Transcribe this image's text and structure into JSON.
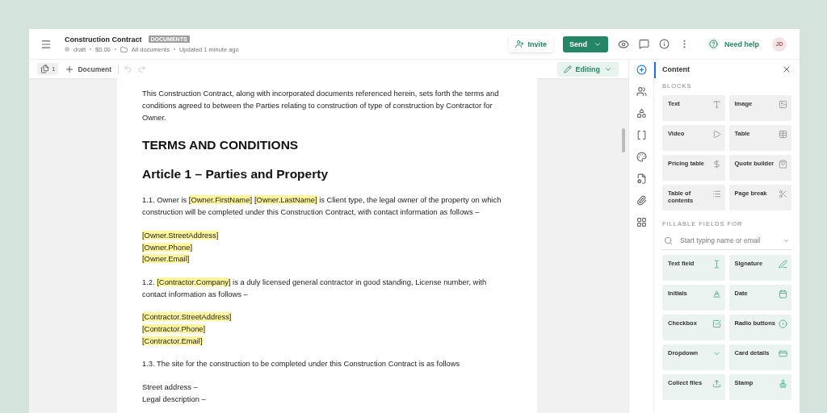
{
  "header": {
    "title": "Construction Contract",
    "badge": "DOCUMENTS",
    "meta": [
      {
        "kind": "status",
        "text": "draft"
      },
      {
        "kind": "plain",
        "text": "$0.00"
      },
      {
        "kind": "folder",
        "text": "All documents"
      },
      {
        "kind": "plain",
        "text": "Updated 1 minute ago"
      }
    ],
    "invite": "Invite",
    "send": "Send",
    "help": "Need help",
    "avatar": "JD"
  },
  "toolbar": {
    "page_count": "1",
    "add_document": "Document",
    "undo_disabled": true,
    "redo_disabled": true,
    "mode": "Editing"
  },
  "document": [
    {
      "kind": "paragraph",
      "parts": [
        {
          "kind": "plain",
          "text": "This Construction Contract, along with incorporated documents referenced herein, sets forth the terms and conditions agreed to between the Parties relating to construction of type of construction by Contractor for Owner."
        }
      ]
    },
    {
      "kind": "title",
      "parts": [
        {
          "kind": "plain",
          "text": "TERMS AND CONDITIONS"
        }
      ]
    },
    {
      "kind": "heading",
      "parts": [
        {
          "kind": "plain",
          "text": "Article 1 – Parties and Property"
        }
      ]
    },
    {
      "kind": "paragraph",
      "parts": [
        {
          "kind": "plain",
          "text": "1.1. Owner is "
        },
        {
          "kind": "token",
          "text": "[Owner.FirstName]"
        },
        {
          "kind": "token",
          "text": "[Owner.LastName]"
        },
        {
          "kind": "plain",
          "text": " is Client type, the legal owner of the property on which construction will be completed under this Construction Contract, with contact information as follows –"
        }
      ]
    },
    {
      "kind": "fields",
      "parts": [
        {
          "kind": "token",
          "text": "[Owner.StreetAddress]"
        },
        {
          "kind": "token",
          "text": "[Owner.Phone]"
        },
        {
          "kind": "token",
          "text": "[Owner.Email]"
        }
      ]
    },
    {
      "kind": "paragraph",
      "parts": [
        {
          "kind": "plain",
          "text": "1.2. "
        },
        {
          "kind": "token",
          "text": "[Contractor.Company]"
        },
        {
          "kind": "plain",
          "text": " is a duly licensed general contractor in good standing, License number, with contact information as follows –"
        }
      ]
    },
    {
      "kind": "fields",
      "parts": [
        {
          "kind": "token",
          "text": "[Contractor.StreetAddress]"
        },
        {
          "kind": "token",
          "text": "[Contractor.Phone]"
        },
        {
          "kind": "token",
          "text": "[Contractor.Email]"
        }
      ]
    },
    {
      "kind": "paragraph",
      "parts": [
        {
          "kind": "plain",
          "text": "1.3. The site for the construction to be completed under this Construction Contract is as follows"
        }
      ]
    },
    {
      "kind": "fields",
      "parts": [
        {
          "kind": "plain",
          "text": "Street address –"
        },
        {
          "kind": "plain",
          "text": "Legal description –"
        }
      ]
    }
  ],
  "rail": [
    {
      "selected": true
    },
    {
      "selected": false
    },
    {
      "selected": false
    },
    {
      "selected": false
    },
    {
      "selected": false
    },
    {
      "selected": false
    },
    {
      "selected": false
    },
    {
      "selected": false
    }
  ],
  "panel": {
    "title": "Content",
    "blocks_heading": "BLOCKS",
    "blocks": [
      {
        "label": "Text"
      },
      {
        "label": "Image"
      },
      {
        "label": "Video"
      },
      {
        "label": "Table"
      },
      {
        "label": "Pricing table"
      },
      {
        "label": "Quote builder"
      },
      {
        "label": "Table of contents"
      },
      {
        "label": "Page break"
      }
    ],
    "fields_heading": "FILLABLE FIELDS FOR",
    "search": {
      "placeholder": "Start typing name or email"
    },
    "fields": [
      {
        "label": "Text field"
      },
      {
        "label": "Signature"
      },
      {
        "label": "Initials"
      },
      {
        "label": "Date"
      },
      {
        "label": "Checkbox"
      },
      {
        "label": "Radio buttons"
      },
      {
        "label": "Dropdown"
      },
      {
        "label": "Card details"
      },
      {
        "label": "Collect files"
      },
      {
        "label": "Stamp"
      }
    ]
  }
}
